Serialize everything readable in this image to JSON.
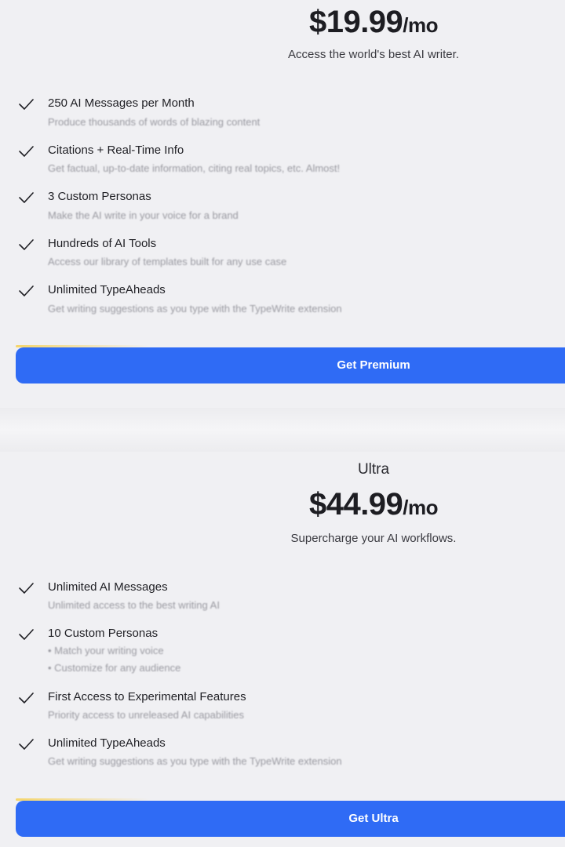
{
  "premium": {
    "price_amount": "$19.99",
    "price_period": "/mo",
    "tagline": "Access the world's best AI writer.",
    "features": [
      {
        "title": "250 AI Messages per Month",
        "desc": "Produce thousands of words of blazing content"
      },
      {
        "title": "Citations + Real-Time Info",
        "desc": "Get factual, up-to-date information, citing real topics, etc. Almost!"
      },
      {
        "title": "3 Custom Personas",
        "desc": "Make the AI write in your voice for a brand"
      },
      {
        "title": "Hundreds of AI Tools",
        "desc": "Access our library of templates built for any use case"
      },
      {
        "title": "Unlimited TypeAheads",
        "desc": "Get writing suggestions as you type with the TypeWrite extension"
      }
    ],
    "cta_label": "Get Premium"
  },
  "ultra": {
    "name": "Ultra",
    "price_amount": "$44.99",
    "price_period": "/mo",
    "tagline": "Supercharge your AI workflows.",
    "features": [
      {
        "title": "Unlimited AI Messages",
        "desc": [
          "Unlimited access to the best writing AI"
        ]
      },
      {
        "title": "10 Custom Personas",
        "desc": [
          "• Match your writing voice",
          "• Customize for any audience"
        ]
      },
      {
        "title": "First Access to Experimental Features",
        "desc": [
          "Priority access to unreleased AI capabilities"
        ]
      },
      {
        "title": "Unlimited TypeAheads",
        "desc": [
          "Get writing suggestions as you type with the TypeWrite extension"
        ]
      }
    ],
    "cta_label": "Get Ultra"
  },
  "icons": {
    "feature_check": "checkmark-icon"
  },
  "colors": {
    "accent": "#2f6bf5",
    "background": "#f0f0f3",
    "highlight": "#f5d56b"
  }
}
